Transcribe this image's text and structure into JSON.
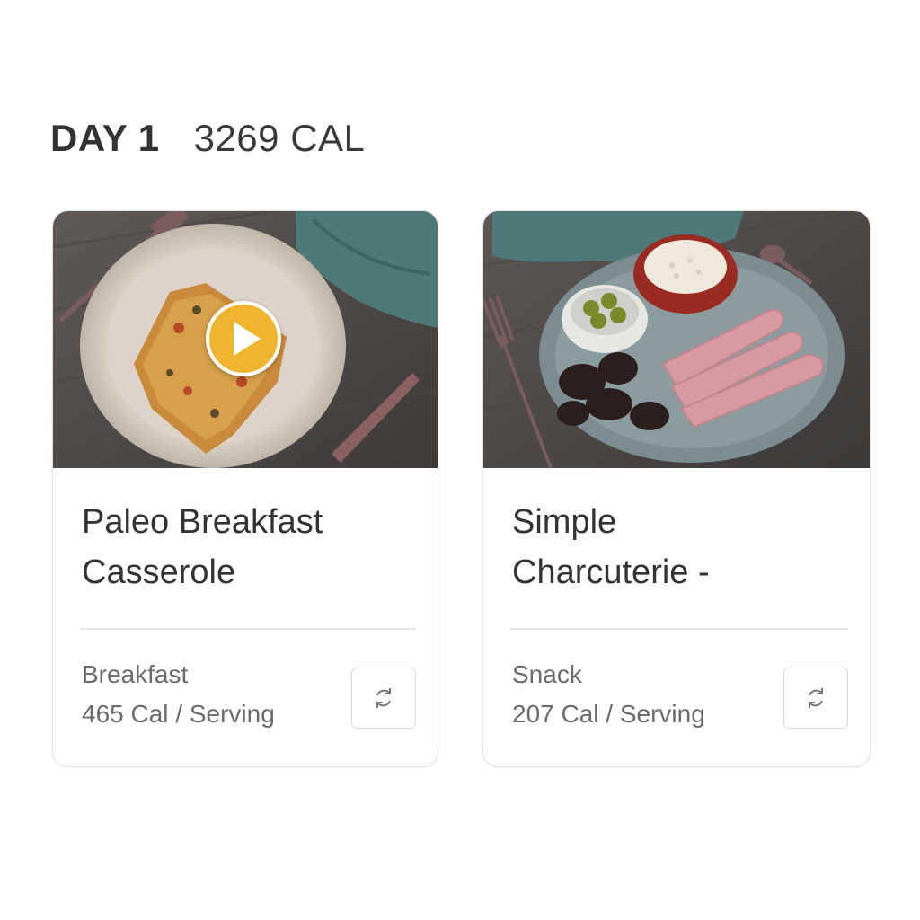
{
  "plan": {
    "day_label": "DAY 1",
    "total_calories": "3269 CAL"
  },
  "cards": [
    {
      "title_line1": "Paleo Breakfast",
      "title_line2": "Casserole",
      "meal_type": "Breakfast",
      "calories": "465 Cal / Serving",
      "has_video": true,
      "icons": {
        "play": "play-icon",
        "swap": "swap-icon"
      }
    },
    {
      "title_line1": "Simple",
      "title_line2": "Charcuterie -",
      "meal_type": "Snack",
      "calories": "207 Cal / Serving",
      "has_video": false,
      "icons": {
        "swap": "swap-icon"
      }
    }
  ],
  "colors": {
    "accent_play": "#f0b52e",
    "text_primary": "#333333",
    "text_secondary": "#6b6b6b"
  }
}
